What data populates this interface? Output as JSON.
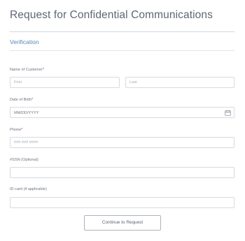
{
  "page": {
    "title": "Request for Confidential Communications"
  },
  "section": {
    "heading": "Verification"
  },
  "fields": {
    "name": {
      "label": "Name of Customer",
      "required_mark": "*",
      "first_placeholder": "First",
      "last_placeholder": "Last"
    },
    "dob": {
      "label": "Date of Birth",
      "required_mark": "*",
      "placeholder": "MM/DD/YYYY",
      "icon": "calendar-icon"
    },
    "phone": {
      "label": "Phone",
      "required_mark": "*",
      "placeholder": "### ### ####"
    },
    "ssn": {
      "label": "#SSN (Optional)",
      "value": ""
    },
    "id_card": {
      "label": "ID card (if applicable)",
      "value": ""
    }
  },
  "actions": {
    "continue_label": "Continue to Request"
  },
  "colors": {
    "accent": "#5b87b7",
    "required": "#d64545",
    "border": "#d6dae0",
    "title": "#5e6773"
  }
}
